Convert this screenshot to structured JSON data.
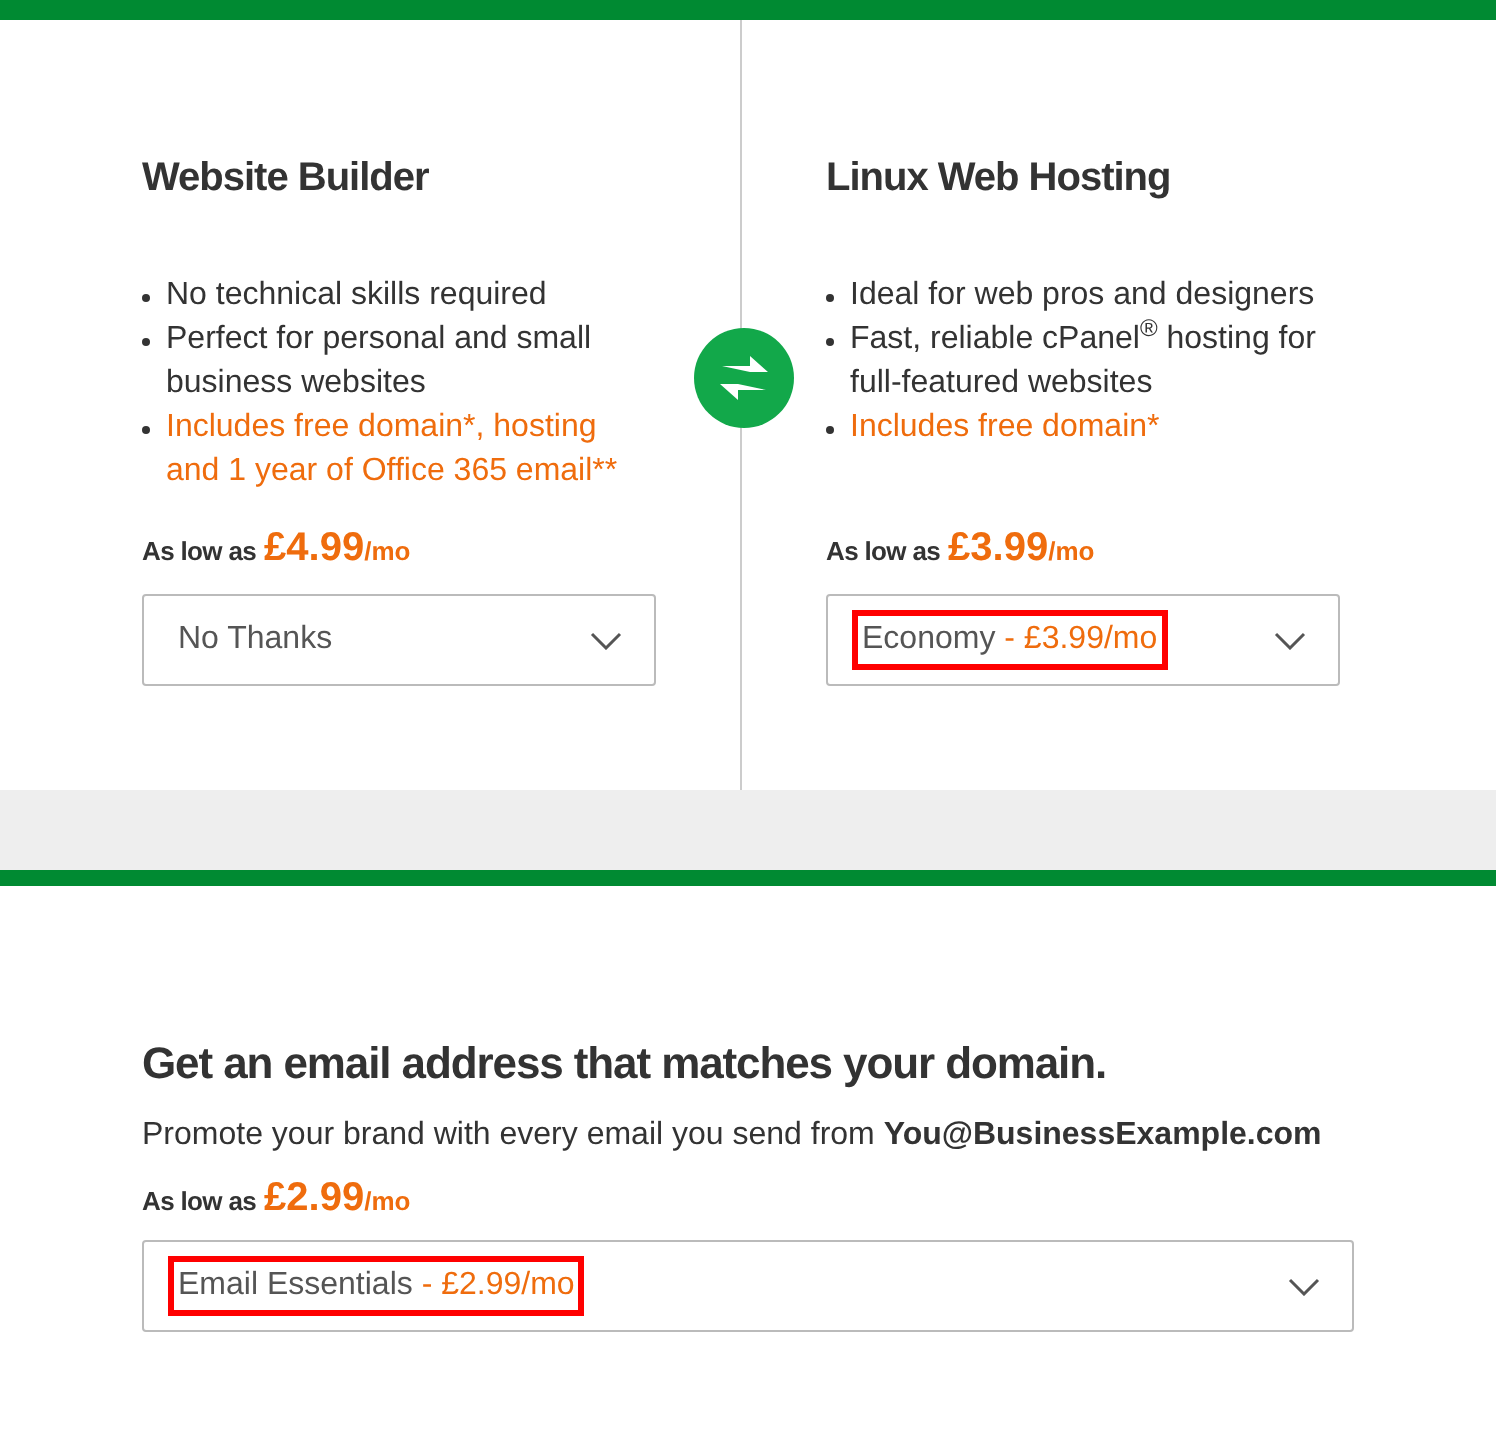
{
  "products": [
    {
      "title": "Website Builder",
      "features": [
        {
          "text": "No technical skills required",
          "highlight": false
        },
        {
          "text": "Perfect for personal and small business websites",
          "highlight": false
        },
        {
          "text": "Includes free domain*, hosting and 1 year of Office 365 email**",
          "highlight": true
        }
      ],
      "price_prefix": "As low as",
      "price": "£4.99",
      "price_unit": "/mo",
      "select": {
        "label": "No Thanks",
        "highlighted": false
      }
    },
    {
      "title": "Linux Web Hosting",
      "features": [
        {
          "text": "Ideal for web pros and designers",
          "highlight": false
        },
        {
          "text": "Fast, reliable cPanel$^{®}$ hosting for full-featured websites",
          "highlight": false
        },
        {
          "text": "Includes free domain*",
          "highlight": true
        }
      ],
      "price_prefix": "As low as",
      "price": "£3.99",
      "price_unit": "/mo",
      "select": {
        "label": "Economy",
        "price": "- £3.99/mo",
        "highlighted": true
      }
    }
  ],
  "email": {
    "title": "Get an email address that matches your domain.",
    "description": "Promote your brand with every email you send from **You@BusinessExample.com**",
    "price_prefix": "As low as",
    "price": "£2.99",
    "price_unit": "/mo",
    "select": {
      "label": "Email Essentials",
      "price": "- £2.99/mo",
      "highlighted": true
    }
  }
}
